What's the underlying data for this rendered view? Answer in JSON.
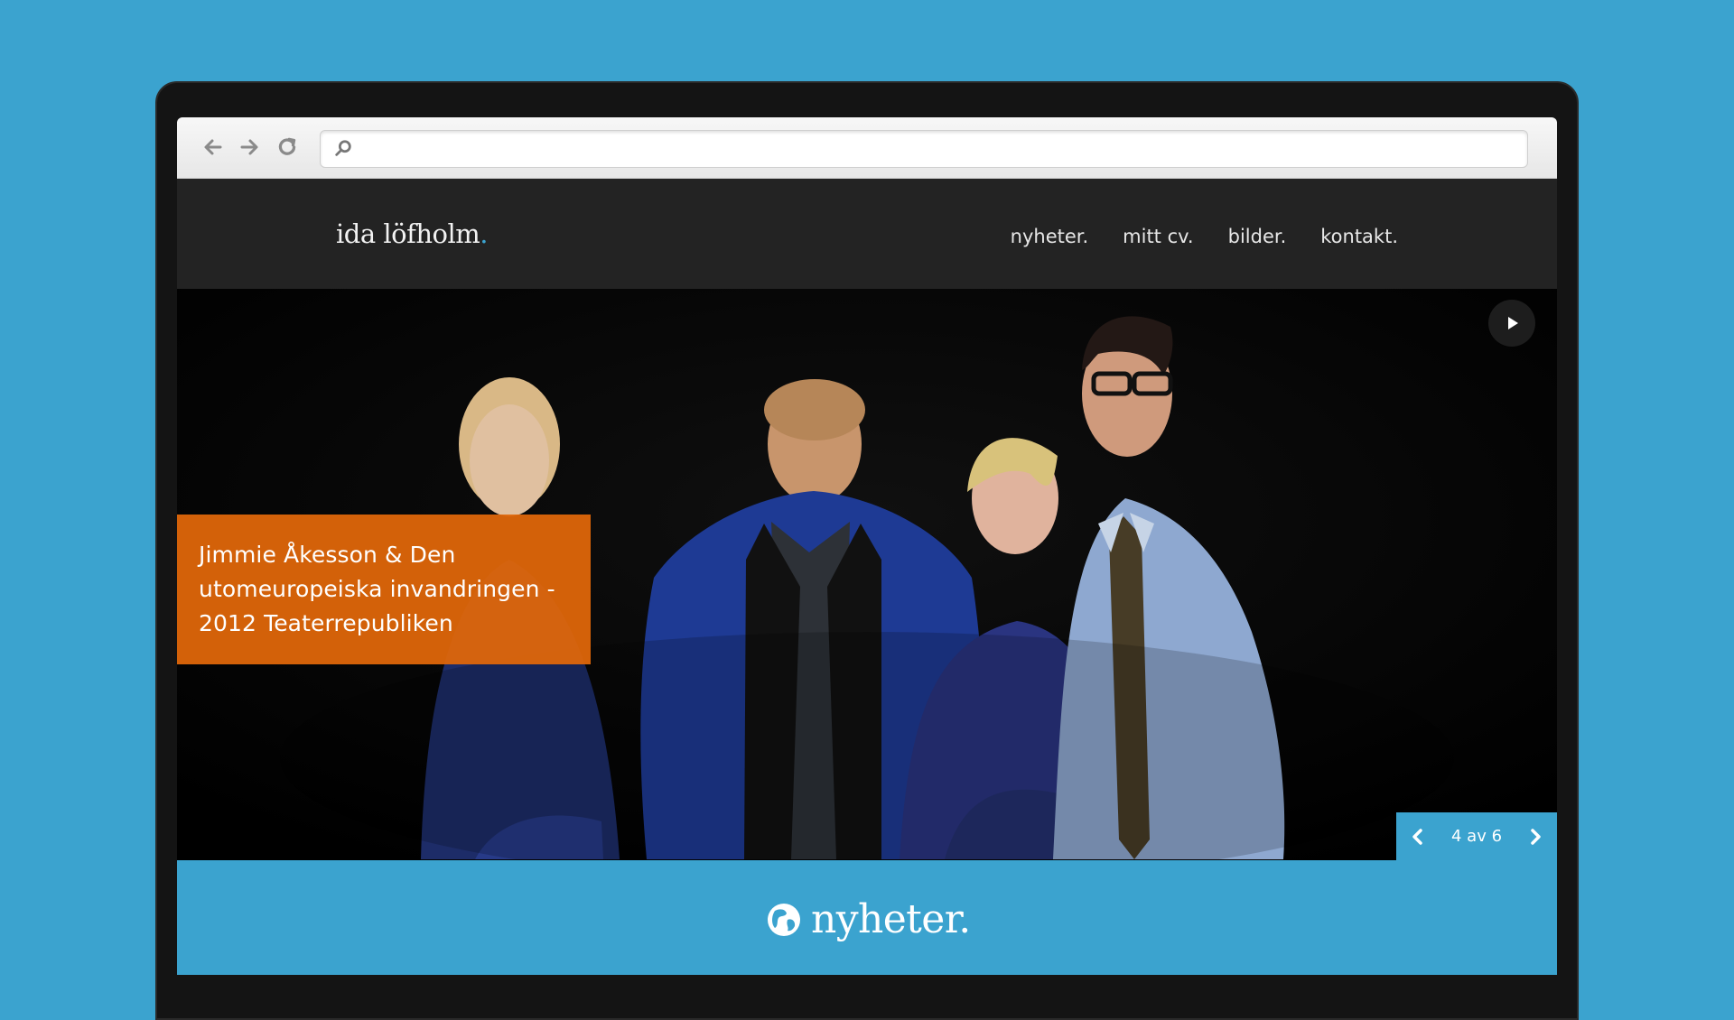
{
  "browser": {
    "back_icon": "back-arrow-icon",
    "forward_icon": "forward-arrow-icon",
    "reload_icon": "reload-icon",
    "search_icon": "search-icon",
    "address_value": ""
  },
  "site": {
    "logo": "ida löfholm",
    "logo_dot": ".",
    "nav": [
      {
        "label": "nyheter."
      },
      {
        "label": "mitt cv."
      },
      {
        "label": "bilder."
      },
      {
        "label": "kontakt."
      }
    ]
  },
  "hero": {
    "caption_line1": "Jimmie Åkesson & Den",
    "caption_line2": "utomeuropeiska invandringen -",
    "caption_line3": "2012 Teaterrepubliken",
    "play_icon": "play-icon",
    "pager_label": "4 av 6"
  },
  "news": {
    "title": "nyheter."
  },
  "colors": {
    "background": "#3ba3cf",
    "header": "#232323",
    "caption": "#e0670a",
    "accent": "#3ba3cf"
  }
}
